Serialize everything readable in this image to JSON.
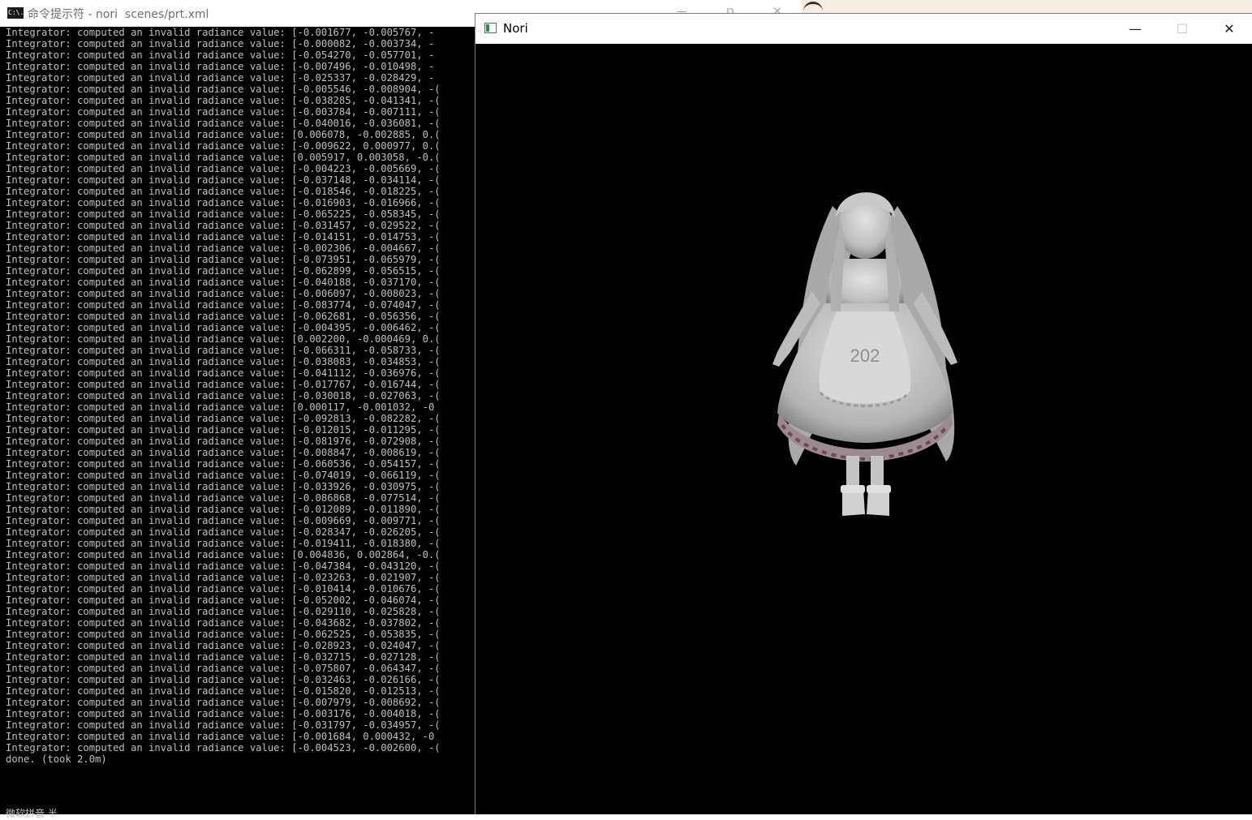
{
  "console": {
    "title": "命令提示符 - nori  scenes/prt.xml",
    "icon": "cmd-icon",
    "icon_text": "C:\\.",
    "controls": {
      "minimize": "—",
      "maximize": "⧉",
      "close": "✕"
    },
    "log_prefix": "Integrator: computed an invalid radiance value: ",
    "log_values": [
      "[-0.001677, -0.005767, -",
      "[-0.000082, -0.003734, -",
      "[-0.054270, -0.057701, -",
      "[-0.007496, -0.010498, -",
      "[-0.025337, -0.028429, -",
      "[-0.005546, -0.008904, -(",
      "[-0.038285, -0.041341, -(",
      "[-0.003784, -0.007111, -(",
      "[-0.040016, -0.036081, -(",
      "[0.006078, -0.002885, 0.(",
      "[-0.009622, 0.000977, 0.(",
      "[0.005917, 0.003058, -0.(",
      "[-0.004223, -0.005669, -(",
      "[-0.037148, -0.034114, -(",
      "[-0.018546, -0.018225, -(",
      "[-0.016903, -0.016966, -(",
      "[-0.065225, -0.058345, -(",
      "[-0.031457, -0.029522, -(",
      "[-0.014151, -0.014753, -(",
      "[-0.002306, -0.004667, -(",
      "[-0.073951, -0.065979, -(",
      "[-0.062899, -0.056515, -(",
      "[-0.040188, -0.037170, -(",
      "[-0.006097, -0.008023, -(",
      "[-0.083774, -0.074047, -(",
      "[-0.062681, -0.056356, -(",
      "[-0.004395, -0.006462, -(",
      "[0.002200, -0.000469, 0.(",
      "[-0.066311, -0.058733, -(",
      "[-0.038083, -0.034853, -(",
      "[-0.041112, -0.036976, -(",
      "[-0.017767, -0.016744, -(",
      "[-0.030018, -0.027063, -(",
      "[0.000117, -0.001032, -0",
      "[-0.092813, -0.082282, -(",
      "[-0.012015, -0.011295, -(",
      "[-0.081976, -0.072908, -(",
      "[-0.008847, -0.008619, -(",
      "[-0.060536, -0.054157, -(",
      "[-0.074019, -0.066119, -(",
      "[-0.033926, -0.030975, -(",
      "[-0.086868, -0.077514, -(",
      "[-0.012089, -0.011890, -(",
      "[-0.009669, -0.009771, -(",
      "[-0.028347, -0.026205, -(",
      "[-0.019411, -0.018380, -(",
      "[0.004836, 0.002864, -0.(",
      "[-0.047384, -0.043120, -(",
      "[-0.023263, -0.021907, -(",
      "[-0.010414, -0.010676, -(",
      "[-0.052002, -0.046074, -(",
      "[-0.029110, -0.025828, -(",
      "[-0.043682, -0.037802, -(",
      "[-0.062525, -0.053835, -(",
      "[-0.028923, -0.024047, -(",
      "[-0.032715, -0.027128, -(",
      "[-0.075807, -0.064347, -(",
      "[-0.032463, -0.026166, -(",
      "[-0.015820, -0.012513, -(",
      "[-0.007979, -0.008692, -(",
      "[-0.003176, -0.004018, -(",
      "[-0.031797, -0.034957, -(",
      "[-0.001684, 0.000432, -0",
      "[-0.004523, -0.002600, -("
    ],
    "done_line": "done. (took 2.0m)",
    "bottom_text": "微软拼音 半"
  },
  "nori": {
    "title": "Nori",
    "icon": "nori-window-icon",
    "buttons": {
      "minimize": "—",
      "maximize": "☐",
      "close": "✕"
    },
    "render": {
      "subject": "rendered-character",
      "apron_text": "202",
      "colors": {
        "background": "#000000",
        "figure": "#cfcfcf",
        "shadow": "#8a8a8a",
        "trim": "#6e4a55"
      }
    }
  }
}
